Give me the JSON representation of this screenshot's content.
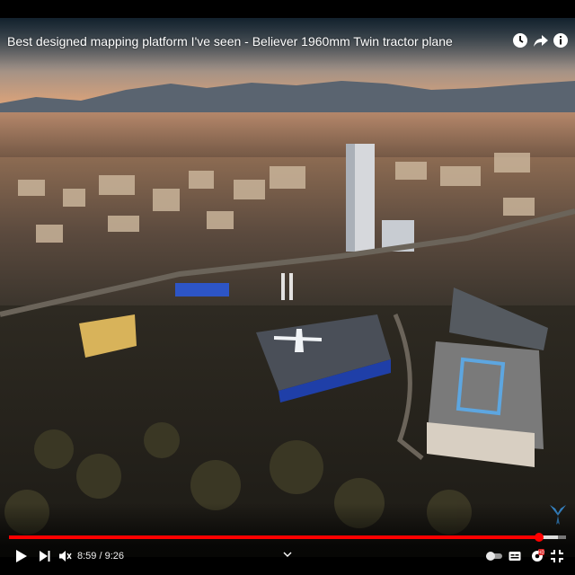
{
  "video": {
    "title": "Best designed mapping platform I've seen - Believer 1960mm Twin tractor plane",
    "state": "paused"
  },
  "player": {
    "time_current": "8:59",
    "time_separator": " / ",
    "time_total": "9:26",
    "progress_fraction": 0.952,
    "buffered_fraction": 0.985
  },
  "colors": {
    "progress_played": "#ff0000",
    "progress_buffered": "#dddddd",
    "progress_track": "#777777",
    "watermark": "#3a8fd6"
  },
  "icons": {
    "watch_later": "clock-icon",
    "share": "share-arrow-icon",
    "info": "info-icon",
    "play": "play-icon",
    "next": "next-icon",
    "volume": "volume-muted-icon",
    "chevron": "chevron-down-icon",
    "autoplay": "autoplay-toggle-icon",
    "subtitles": "subtitles-icon",
    "settings": "settings-gear-icon",
    "fullscreen": "exit-fullscreen-icon",
    "watermark": "channel-logo-icon"
  }
}
